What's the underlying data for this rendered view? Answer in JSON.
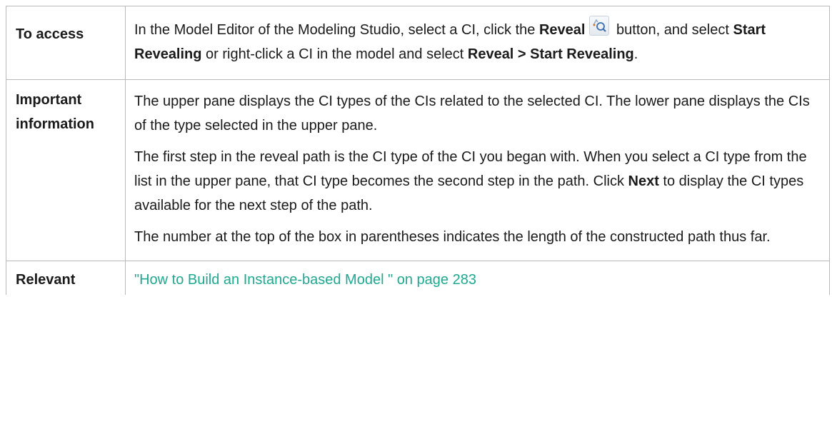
{
  "rows": {
    "access": {
      "label": "To access",
      "text_1": "In the Model Editor of the Modeling Studio, select a CI, click the ",
      "bold_reveal": "Reveal",
      "icon": "reveal-icon",
      "text_2": " button, and select ",
      "bold_start_revealing": "Start Revealing",
      "text_3": " or right-click a CI in the model and select ",
      "bold_reveal_path": "Reveal > Start Revealing",
      "text_4": "."
    },
    "important": {
      "label_line1": "Important",
      "label_line2": "information",
      "para_1": "The upper pane displays the CI types of the CIs related to the selected CI. The lower pane displays the CIs of the type selected in the upper pane.",
      "para_2_a": "The first step in the reveal path is the CI type of the CI you began with. When you select a CI type from the list in the upper pane, that CI type becomes the second step in the path. Click ",
      "para_2_bold": "Next",
      "para_2_b": " to display the CI types available for the next step of the path.",
      "para_3": "The number at the top of the box in parentheses indicates the length of the constructed path thus far."
    },
    "relevant": {
      "label": "Relevant",
      "link_text": "\"How to Build an Instance-based Model \" on page 283"
    }
  },
  "colors": {
    "link": "#1fa88e",
    "border": "#b9b9b9"
  }
}
